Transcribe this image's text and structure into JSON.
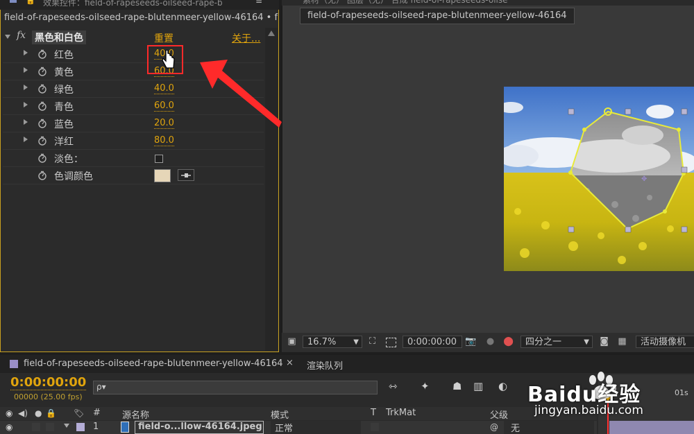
{
  "effects_panel": {
    "tab_title": "效果控件：field-of-rapeseeds-oilseed-rape-b",
    "layer_path": "field-of-rapeseeds-oilseed-rape-blutenmeer-yellow-46164 • f",
    "effect_name": "黑色和白色",
    "reset_label": "重置",
    "about_label": "关于...",
    "properties": [
      {
        "label": "红色",
        "value": "40.0"
      },
      {
        "label": "黄色",
        "value": "60.0"
      },
      {
        "label": "绿色",
        "value": "40.0"
      },
      {
        "label": "青色",
        "value": "60.0"
      },
      {
        "label": "蓝色",
        "value": "20.0"
      },
      {
        "label": "洋红",
        "value": "80.0"
      }
    ],
    "tint_label": "淡色：",
    "tint_color_label": "色调颜色",
    "tint_color": "#e6d6b8"
  },
  "comp_panel": {
    "top_tabs": "素材（无）   图层（无）   合成 field-of-rapeseeds-oilse",
    "comp_tab_name": "field-of-rapeseeds-oilseed-rape-blutenmeer-yellow-46164",
    "zoom": "16.7%",
    "timecode": "0:00:00:00",
    "resolution": "四分之一",
    "camera": "活动摄像机"
  },
  "timeline": {
    "comp_tab": "field-of-rapeseeds-oilseed-rape-blutenmeer-yellow-46164",
    "render_queue_tab": "渲染队列",
    "current_time": "0:00:00:00",
    "fps_info": "00000 (25.00 fps)",
    "search_placeholder": "ρ▾",
    "col_num": "#",
    "col_source": "源名称",
    "col_mode": "模式",
    "col_t": "T",
    "col_trkmat": "TrkMat",
    "col_parent": "父级",
    "layer_num": "1",
    "layer_name": "field-o...llow-46164.jpeg",
    "layer_mode": "正常",
    "layer_parent": "无",
    "ruler_mark": "01s"
  },
  "watermark": {
    "brand": "Baidu经验",
    "url": "jingyan.baidu.com"
  },
  "accent_color": "#e0a40d",
  "annotation_color": "#ff2a2a"
}
